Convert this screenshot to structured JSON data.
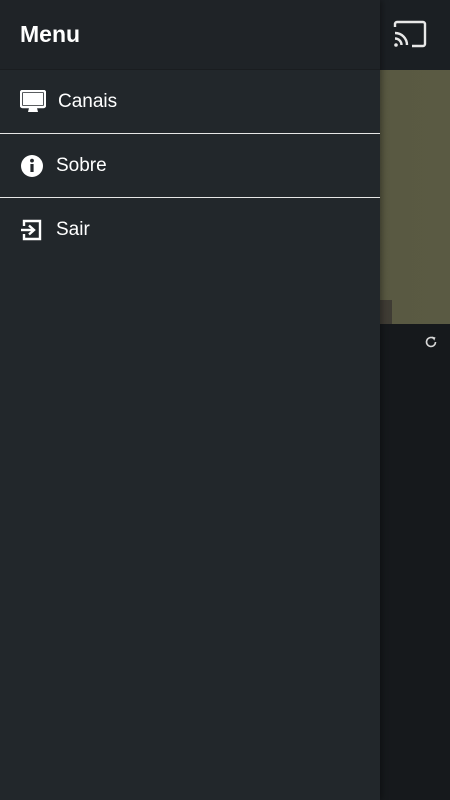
{
  "drawer": {
    "title": "Menu",
    "items": [
      {
        "label": "Canais",
        "icon": "monitor-icon"
      },
      {
        "label": "Sobre",
        "icon": "info-icon"
      },
      {
        "label": "Sair",
        "icon": "exit-icon"
      }
    ]
  },
  "app": {
    "cast_icon": "cast-icon",
    "refresh_icon": "refresh-icon"
  },
  "colors": {
    "drawer_bg": "#22272b",
    "header_bg": "#1f2327",
    "divider": "#e6e6e6",
    "video_bg": "#55553f"
  }
}
